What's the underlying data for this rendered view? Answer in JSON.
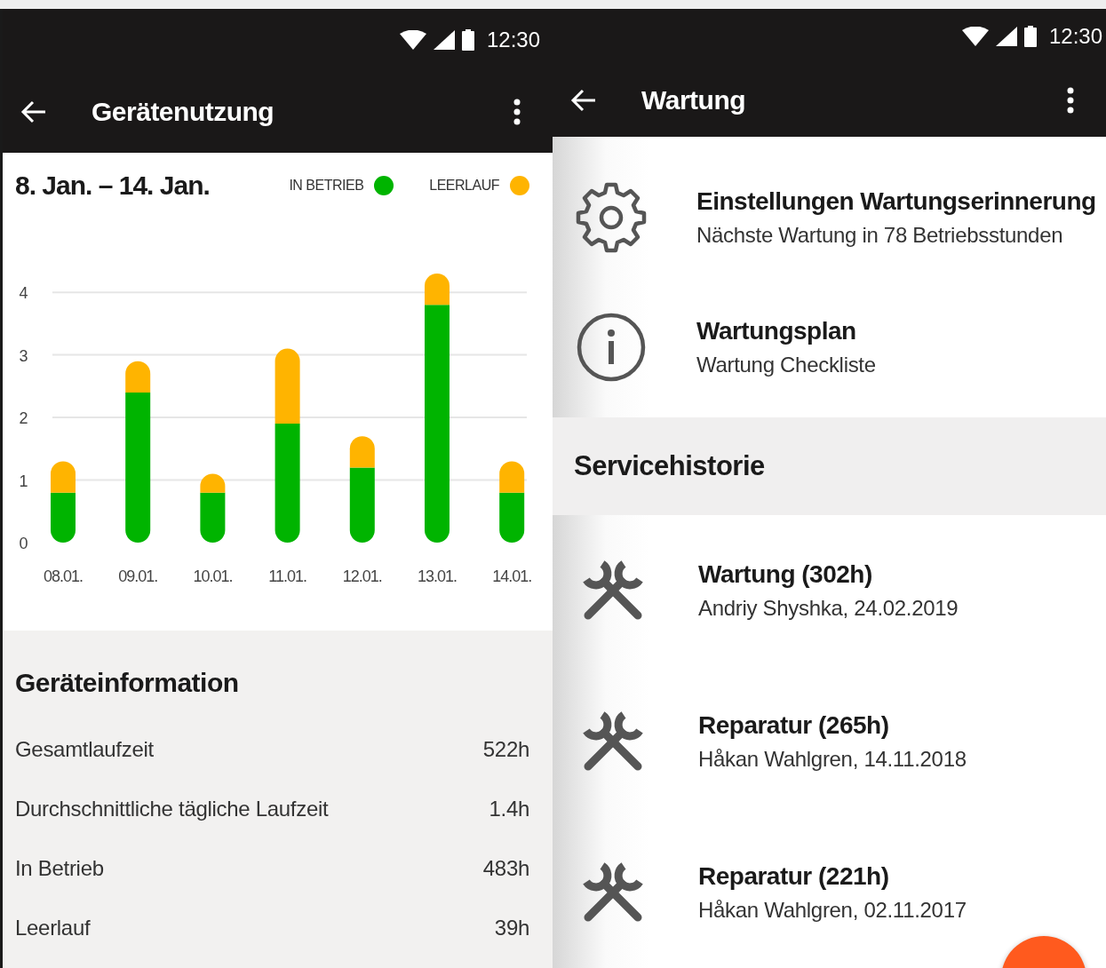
{
  "left_screen": {
    "status_bar": {
      "time": "12:30"
    },
    "app_bar": {
      "title": "Gerätenutzung"
    },
    "usage": {
      "date_range": "8. Jan. – 14. Jan.",
      "chart_data": {
        "type": "bar",
        "stacked": true,
        "categories": [
          "08.01.",
          "09.01.",
          "10.01.",
          "11.01.",
          "12.01.",
          "13.01.",
          "14.01."
        ],
        "series": [
          {
            "name": "IN BETRIEB",
            "color": "#00b400",
            "values": [
              0.8,
              2.4,
              0.8,
              1.9,
              1.2,
              3.8,
              0.8
            ]
          },
          {
            "name": "LEERLAUF",
            "color": "#ffb400",
            "values": [
              0.5,
              0.5,
              0.3,
              1.2,
              0.5,
              0.5,
              0.5
            ]
          }
        ],
        "grid": true,
        "ylim": [
          0,
          4.3
        ],
        "yticks": [
          0,
          1,
          2,
          3,
          4
        ]
      }
    },
    "info": {
      "title": "Geräteinformation",
      "rows": [
        {
          "label": "Gesamtlaufzeit",
          "value": "522h"
        },
        {
          "label": "Durchschnittliche tägliche Laufzeit",
          "value": "1.4h"
        },
        {
          "label": "In Betrieb",
          "value": "483h"
        },
        {
          "label": "Leerlauf",
          "value": "39h"
        }
      ]
    }
  },
  "right_screen": {
    "status_bar": {
      "time": "12:30"
    },
    "app_bar": {
      "title": "Wartung"
    },
    "items": [
      {
        "kind": "settings",
        "title": "Einstellungen Wartungserinnerung",
        "subtitle": "Nächste Wartung in 78 Betriebsstunden"
      },
      {
        "kind": "info",
        "title": "Wartungsplan",
        "subtitle": "Wartung Checkliste"
      }
    ],
    "service_history": {
      "title": "Servicehistorie",
      "entries": [
        {
          "title": "Wartung (302h)",
          "subtitle": "Andriy Shyshka, 24.02.2019"
        },
        {
          "title": "Reparatur (265h)",
          "subtitle": "Håkan Wahlgren, 14.11.2018"
        },
        {
          "title": "Reparatur (221h)",
          "subtitle": "Håkan Wahlgren, 02.11.2017"
        }
      ]
    }
  }
}
